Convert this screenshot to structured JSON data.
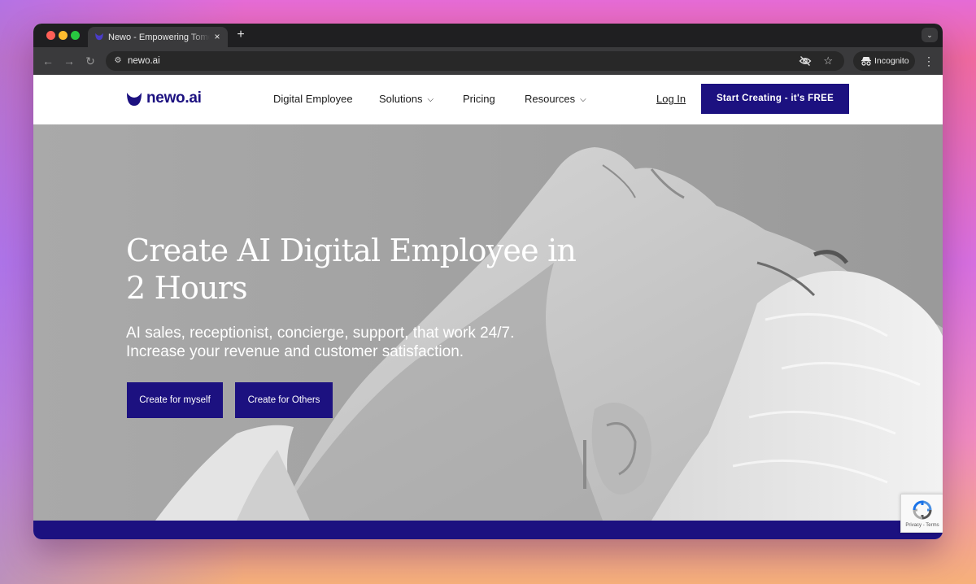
{
  "browser": {
    "tab_title": "Newo - Empowering Tomorrow",
    "tab_close": "×",
    "new_tab": "+",
    "url": "newo.ai",
    "incognito_label": "Incognito"
  },
  "site": {
    "logo_text": "newo.ai",
    "nav": [
      {
        "label": "Digital Employee",
        "has_dropdown": false
      },
      {
        "label": "Solutions",
        "has_dropdown": true
      },
      {
        "label": "Pricing",
        "has_dropdown": false
      },
      {
        "label": "Resources",
        "has_dropdown": true
      }
    ],
    "login_label": "Log In",
    "cta_label": "Start Creating - it's FREE"
  },
  "hero": {
    "title": "Create AI Digital Employee in 2 Hours",
    "subtitle_line1": "AI sales, receptionist, concierge, support, that work 24/7.",
    "subtitle_line2": "Increase your revenue and customer satisfaction.",
    "button_myself": "Create for myself",
    "button_others": "Create for Others"
  },
  "recaptcha": {
    "text": "Privacy - Terms"
  },
  "colors": {
    "brand": "#1c1180",
    "tab_bg": "#3a3a3c",
    "chrome": "#1f1f21"
  },
  "icons": {
    "back": "arrow-left-icon",
    "forward": "arrow-right-icon",
    "reload": "reload-icon",
    "site_settings": "tune-icon",
    "eye_off": "eye-off-icon",
    "bookmark": "star-icon",
    "incognito": "incognito-icon",
    "menu": "kebab-menu-icon",
    "dropdown": "chevron-down-icon"
  }
}
